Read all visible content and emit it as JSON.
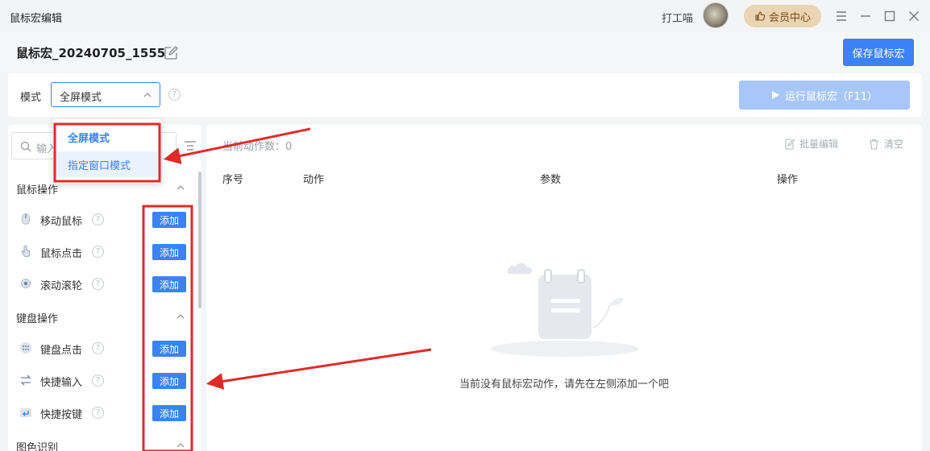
{
  "window": {
    "app_title": "鼠标宏编辑",
    "username": "打工喵",
    "vip_label": "会员中心"
  },
  "header": {
    "macro_name": "鼠标宏_20240705_1555",
    "save_label": "保存鼠标宏"
  },
  "mode": {
    "label": "模式",
    "selected": "全屏模式",
    "options": [
      "全屏模式",
      "指定窗口模式"
    ],
    "run_label": "运行鼠标宏（F11）"
  },
  "left_panel": {
    "search_placeholder": "输入",
    "add_label": "添加",
    "sections": [
      {
        "title": "鼠标操作",
        "items": [
          {
            "label": "移动鼠标",
            "icon": "mouse-icon"
          },
          {
            "label": "鼠标点击",
            "icon": "pointer-hand-icon"
          },
          {
            "label": "滚动滚轮",
            "icon": "scroll-gear-icon"
          }
        ]
      },
      {
        "title": "键盘操作",
        "items": [
          {
            "label": "键盘点击",
            "icon": "keypad-icon"
          },
          {
            "label": "快捷输入",
            "icon": "swap-arrows-icon"
          },
          {
            "label": "快捷按键",
            "icon": "enter-key-icon"
          }
        ]
      },
      {
        "title": "图色识别",
        "items": []
      }
    ]
  },
  "right_panel": {
    "count_label": "当前动作数：0",
    "batch_edit": "批量编辑",
    "clear": "清空",
    "columns": [
      "序号",
      "动作",
      "参数",
      "操作"
    ],
    "empty_text": "当前没有鼠标宏动作，请先在左侧添加一个吧"
  },
  "colors": {
    "accent": "#3b82f6",
    "annotation": "#e02a2a",
    "run_disabled": "#a7c7fa",
    "vip_bg": "#ead4b2"
  }
}
